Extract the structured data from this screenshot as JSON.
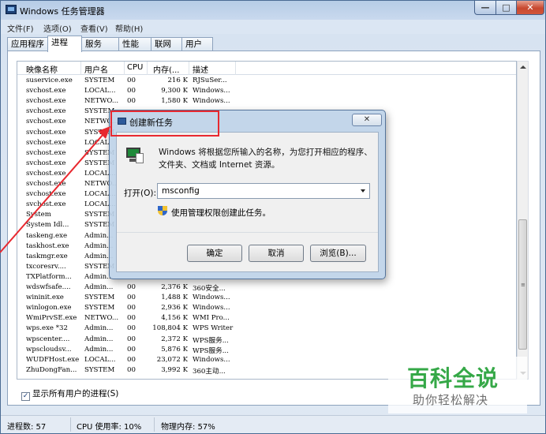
{
  "window": {
    "title": "Windows 任务管理器",
    "min_glyph": "—",
    "max_glyph": "□",
    "close_glyph": "✕"
  },
  "menu": [
    "文件(F)",
    "选项(O)",
    "查看(V)",
    "帮助(H)"
  ],
  "tabs": [
    "应用程序",
    "进程",
    "服务",
    "性能",
    "联网",
    "用户"
  ],
  "active_tab": 1,
  "columns": [
    "映像名称",
    "用户名",
    "CPU",
    "内存(...",
    "描述"
  ],
  "rows": [
    [
      "suservice.exe",
      "SYSTEM",
      "00",
      "216 K",
      "RJSuSer..."
    ],
    [
      "svchost.exe",
      "LOCAL...",
      "00",
      "9,300 K",
      "Windows..."
    ],
    [
      "svchost.exe",
      "NETWO...",
      "00",
      "1,580 K",
      "Windows..."
    ],
    [
      "svchost.exe",
      "SYSTEM",
      "",
      "",
      ""
    ],
    [
      "svchost.exe",
      "NETWO...",
      "",
      "",
      ""
    ],
    [
      "svchost.exe",
      "SYSTEM",
      "",
      "",
      ""
    ],
    [
      "svchost.exe",
      "LOCAL",
      "",
      "",
      ""
    ],
    [
      "svchost.exe",
      "SYSTEM",
      "",
      "",
      ""
    ],
    [
      "svchost.exe",
      "SYSTEM",
      "",
      "",
      ""
    ],
    [
      "svchost.exe",
      "LOCAL...",
      "",
      "",
      ""
    ],
    [
      "svchost.exe",
      "NETWO...",
      "",
      "",
      ""
    ],
    [
      "svchost.exe",
      "LOCAL...",
      "",
      "",
      ""
    ],
    [
      "svchost.exe",
      "LOCAL...",
      "",
      "",
      ""
    ],
    [
      "System",
      "SYSTEM",
      "",
      "",
      ""
    ],
    [
      "System Idl...",
      "SYSTEM",
      "",
      "",
      ""
    ],
    [
      "taskeng.exe",
      "Admin...",
      "",
      "",
      ""
    ],
    [
      "taskhost.exe",
      "Admin...",
      "",
      "",
      ""
    ],
    [
      "taskmgr.exe",
      "Admin...",
      "",
      "",
      ""
    ],
    [
      "txcoresrv....",
      "SYSTEM",
      "",
      "",
      ""
    ],
    [
      "TXPlatform...",
      "Admin...",
      "",
      "",
      ""
    ],
    [
      "wdswfsafe....",
      "Admin...",
      "00",
      "2,376 K",
      "360安全..."
    ],
    [
      "wininit.exe",
      "SYSTEM",
      "00",
      "1,488 K",
      "Windows..."
    ],
    [
      "winlogon.exe",
      "SYSTEM",
      "00",
      "2,936 K",
      "Windows..."
    ],
    [
      "WmiPrvSE.exe",
      "NETWO...",
      "00",
      "4,156 K",
      "WMI Pro..."
    ],
    [
      "wps.exe *32",
      "Admin...",
      "00",
      "108,804 K",
      "WPS Writer"
    ],
    [
      "wpscenter....",
      "Admin...",
      "00",
      "2,372 K",
      "WPS服务..."
    ],
    [
      "wpscloudsv...",
      "Admin...",
      "00",
      "5,876 K",
      "WPS服务..."
    ],
    [
      "WUDFHost.exe",
      "LOCAL...",
      "00",
      "23,072 K",
      "Windows..."
    ],
    [
      "ZhuDongFan...",
      "SYSTEM",
      "00",
      "3,992 K",
      "360主动..."
    ]
  ],
  "show_all_users": {
    "label": "显示所有用户的进程(S)",
    "checked": true,
    "check_glyph": "✓"
  },
  "status": {
    "processes": "进程数: 57",
    "cpu": "CPU 使用率: 10%",
    "memory": "物理内存: 57%"
  },
  "scrollbar": {
    "grip_glyph": "≡"
  },
  "dialog": {
    "title": "创建新任务",
    "close_glyph": "✕",
    "desc_line1": "Windows 将根据您所输入的名称，为您打开相应的程序、",
    "desc_line2": "文件夹、文档或 Internet 资源。",
    "open_label": "打开(O):",
    "open_value": "msconfig",
    "admin_text": "使用管理权限创建此任务。",
    "ok": "确定",
    "cancel": "取消",
    "browse": "浏览(B)..."
  },
  "watermark": {
    "logo": "百科全说",
    "subtitle": "助你轻松解决",
    "logo_color": "#35a847"
  },
  "annotation": {
    "color": "#e8282f"
  }
}
